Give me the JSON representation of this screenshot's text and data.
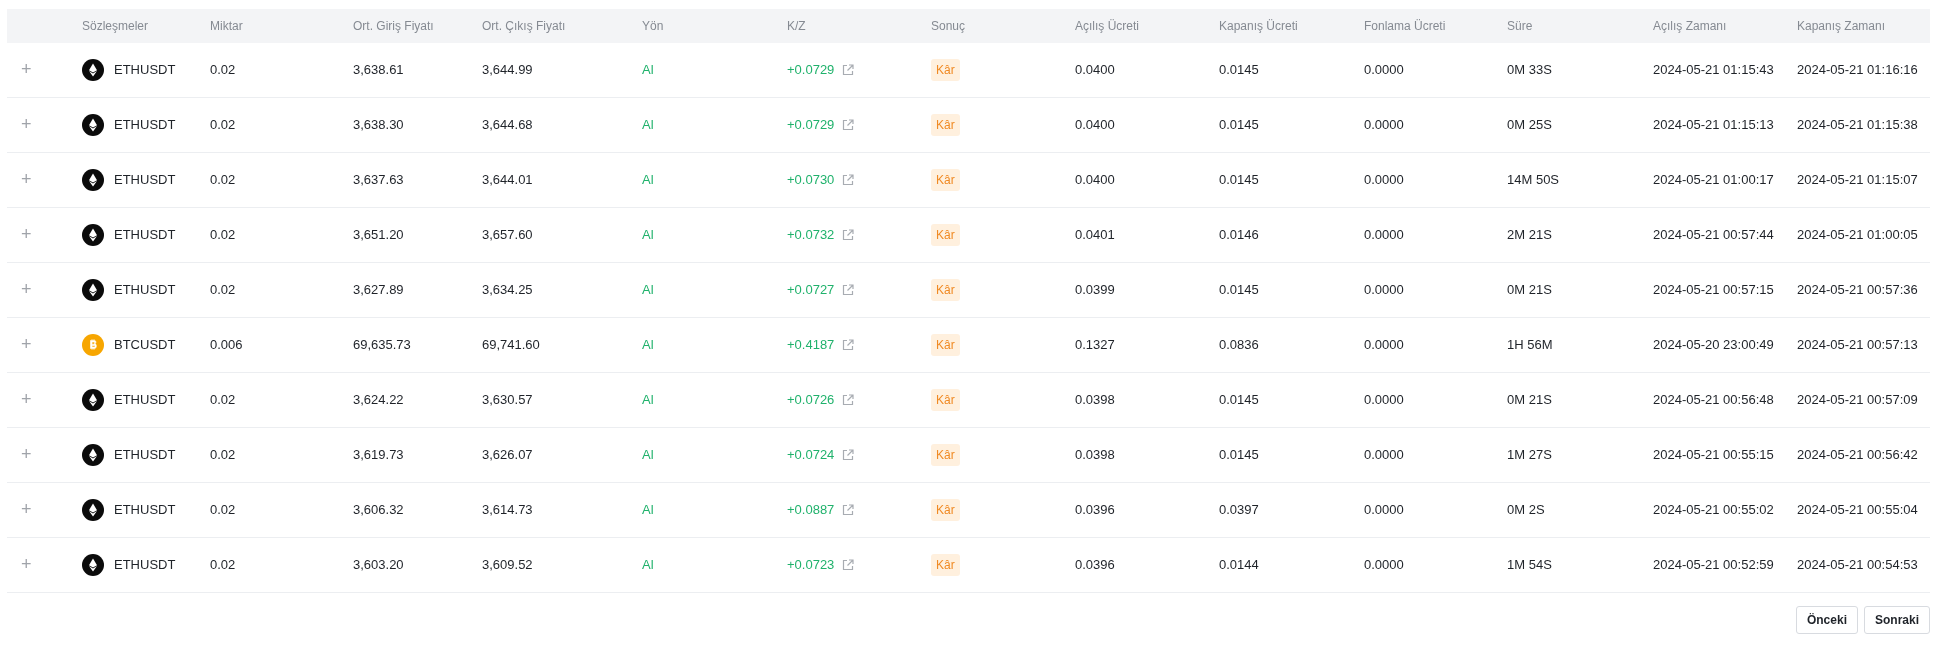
{
  "table": {
    "columns": [
      "Sözleşmeler",
      "Miktar",
      "Ort. Giriş Fiyatı",
      "Ort. Çıkış Fiyatı",
      "Yön",
      "K/Z",
      "Sonuç",
      "Açılış Ücreti",
      "Kapanış Ücreti",
      "Fonlama Ücreti",
      "Süre",
      "Açılış Zamanı",
      "Kapanış Zamanı"
    ],
    "rows": [
      {
        "expand": "+",
        "kind": "eth",
        "symbol": "ETHUSDT",
        "amount": "0.02",
        "entry": "3,638.61",
        "exit": "3,644.99",
        "side": "Al",
        "pnl": "+0.0729",
        "result": "Kâr",
        "open_fee": "0.0400",
        "close_fee": "0.0145",
        "funding_fee": "0.0000",
        "duration": "0M 33S",
        "open_time": "2024-05-21 01:15:43",
        "close_time": "2024-05-21 01:16:16"
      },
      {
        "expand": "+",
        "kind": "eth",
        "symbol": "ETHUSDT",
        "amount": "0.02",
        "entry": "3,638.30",
        "exit": "3,644.68",
        "side": "Al",
        "pnl": "+0.0729",
        "result": "Kâr",
        "open_fee": "0.0400",
        "close_fee": "0.0145",
        "funding_fee": "0.0000",
        "duration": "0M 25S",
        "open_time": "2024-05-21 01:15:13",
        "close_time": "2024-05-21 01:15:38"
      },
      {
        "expand": "+",
        "kind": "eth",
        "symbol": "ETHUSDT",
        "amount": "0.02",
        "entry": "3,637.63",
        "exit": "3,644.01",
        "side": "Al",
        "pnl": "+0.0730",
        "result": "Kâr",
        "open_fee": "0.0400",
        "close_fee": "0.0145",
        "funding_fee": "0.0000",
        "duration": "14M 50S",
        "open_time": "2024-05-21 01:00:17",
        "close_time": "2024-05-21 01:15:07"
      },
      {
        "expand": "+",
        "kind": "eth",
        "symbol": "ETHUSDT",
        "amount": "0.02",
        "entry": "3,651.20",
        "exit": "3,657.60",
        "side": "Al",
        "pnl": "+0.0732",
        "result": "Kâr",
        "open_fee": "0.0401",
        "close_fee": "0.0146",
        "funding_fee": "0.0000",
        "duration": "2M 21S",
        "open_time": "2024-05-21 00:57:44",
        "close_time": "2024-05-21 01:00:05"
      },
      {
        "expand": "+",
        "kind": "eth",
        "symbol": "ETHUSDT",
        "amount": "0.02",
        "entry": "3,627.89",
        "exit": "3,634.25",
        "side": "Al",
        "pnl": "+0.0727",
        "result": "Kâr",
        "open_fee": "0.0399",
        "close_fee": "0.0145",
        "funding_fee": "0.0000",
        "duration": "0M 21S",
        "open_time": "2024-05-21 00:57:15",
        "close_time": "2024-05-21 00:57:36"
      },
      {
        "expand": "+",
        "kind": "btc",
        "symbol": "BTCUSDT",
        "amount": "0.006",
        "entry": "69,635.73",
        "exit": "69,741.60",
        "side": "Al",
        "pnl": "+0.4187",
        "result": "Kâr",
        "open_fee": "0.1327",
        "close_fee": "0.0836",
        "funding_fee": "0.0000",
        "duration": "1H 56M",
        "open_time": "2024-05-20 23:00:49",
        "close_time": "2024-05-21 00:57:13"
      },
      {
        "expand": "+",
        "kind": "eth",
        "symbol": "ETHUSDT",
        "amount": "0.02",
        "entry": "3,624.22",
        "exit": "3,630.57",
        "side": "Al",
        "pnl": "+0.0726",
        "result": "Kâr",
        "open_fee": "0.0398",
        "close_fee": "0.0145",
        "funding_fee": "0.0000",
        "duration": "0M 21S",
        "open_time": "2024-05-21 00:56:48",
        "close_time": "2024-05-21 00:57:09"
      },
      {
        "expand": "+",
        "kind": "eth",
        "symbol": "ETHUSDT",
        "amount": "0.02",
        "entry": "3,619.73",
        "exit": "3,626.07",
        "side": "Al",
        "pnl": "+0.0724",
        "result": "Kâr",
        "open_fee": "0.0398",
        "close_fee": "0.0145",
        "funding_fee": "0.0000",
        "duration": "1M 27S",
        "open_time": "2024-05-21 00:55:15",
        "close_time": "2024-05-21 00:56:42"
      },
      {
        "expand": "+",
        "kind": "eth",
        "symbol": "ETHUSDT",
        "amount": "0.02",
        "entry": "3,606.32",
        "exit": "3,614.73",
        "side": "Al",
        "pnl": "+0.0887",
        "result": "Kâr",
        "open_fee": "0.0396",
        "close_fee": "0.0397",
        "funding_fee": "0.0000",
        "duration": "0M 2S",
        "open_time": "2024-05-21 00:55:02",
        "close_time": "2024-05-21 00:55:04"
      },
      {
        "expand": "+",
        "kind": "eth",
        "symbol": "ETHUSDT",
        "amount": "0.02",
        "entry": "3,603.20",
        "exit": "3,609.52",
        "side": "Al",
        "pnl": "+0.0723",
        "result": "Kâr",
        "open_fee": "0.0396",
        "close_fee": "0.0144",
        "funding_fee": "0.0000",
        "duration": "1M 54S",
        "open_time": "2024-05-21 00:52:59",
        "close_time": "2024-05-21 00:54:53"
      }
    ]
  },
  "pagination": {
    "previous": "Önceki",
    "next": "Sonraki"
  }
}
